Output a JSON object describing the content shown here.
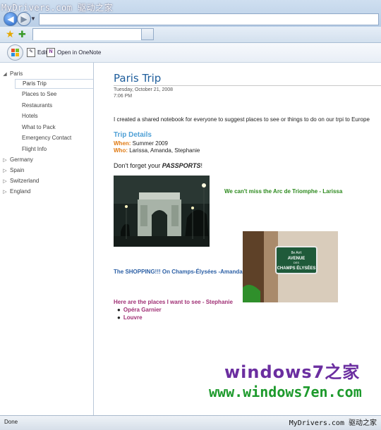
{
  "browser": {
    "watermark_top": "MyDrivers.com 驱动之家",
    "status": "Done",
    "status_watermark": "MyDrivers.com 驱动之家"
  },
  "commandbar": {
    "edit_label": "Edit",
    "open_label": "Open in OneNote"
  },
  "sidebar": {
    "sections": [
      {
        "label": "Paris",
        "expanded": true
      },
      {
        "label": "Germany",
        "expanded": false
      },
      {
        "label": "Spain",
        "expanded": false
      },
      {
        "label": "Switzerland",
        "expanded": false
      },
      {
        "label": "England",
        "expanded": false
      }
    ],
    "pages": [
      {
        "label": "Paris Trip",
        "selected": true
      },
      {
        "label": "Places to See"
      },
      {
        "label": "Restaurants"
      },
      {
        "label": "Hotels"
      },
      {
        "label": "What to Pack"
      },
      {
        "label": "Emergency Contact"
      },
      {
        "label": "Flight Info"
      }
    ]
  },
  "page": {
    "title": "Paris Trip",
    "date": "Tuesday, October 21, 2008",
    "time": "7:06 PM",
    "intro": "I created a shared notebook for everyone to suggest places to see or things to do on our trpi to Europe",
    "trip_heading": "Trip Details",
    "when_label": "When:",
    "when_value": "Summer 2009",
    "who_label": "Who:",
    "who_value": "Larissa, Amanda, Stephanie",
    "passports_prefix": "Don't forget your ",
    "passports_bold": "PASSPORTS",
    "passports_suffix": "!",
    "caption_arc": "We can't miss the Arc de Triomphe - Larissa",
    "caption_shopping": "The SHOPPING!!! On Champs-Élysées -Amanda",
    "caption_places": "Here are the places I want to see - Stephanie",
    "places": [
      "Opéra Garnier",
      "Louvre"
    ],
    "sign_line1": "8e Arrt",
    "sign_line2": "AVENUE",
    "sign_line3": "DES",
    "sign_line4": "CHAMPS ÉLYSÉES"
  },
  "watermark": {
    "brand": "windows7之家",
    "url": "www.windows7en.com"
  },
  "colors": {
    "title": "#1f5e9c",
    "heading": "#4fa0d6",
    "label_orange": "#e07a12",
    "caption_green": "#2d8a1e",
    "caption_blue": "#2b5fa5",
    "caption_purple": "#a03075"
  }
}
